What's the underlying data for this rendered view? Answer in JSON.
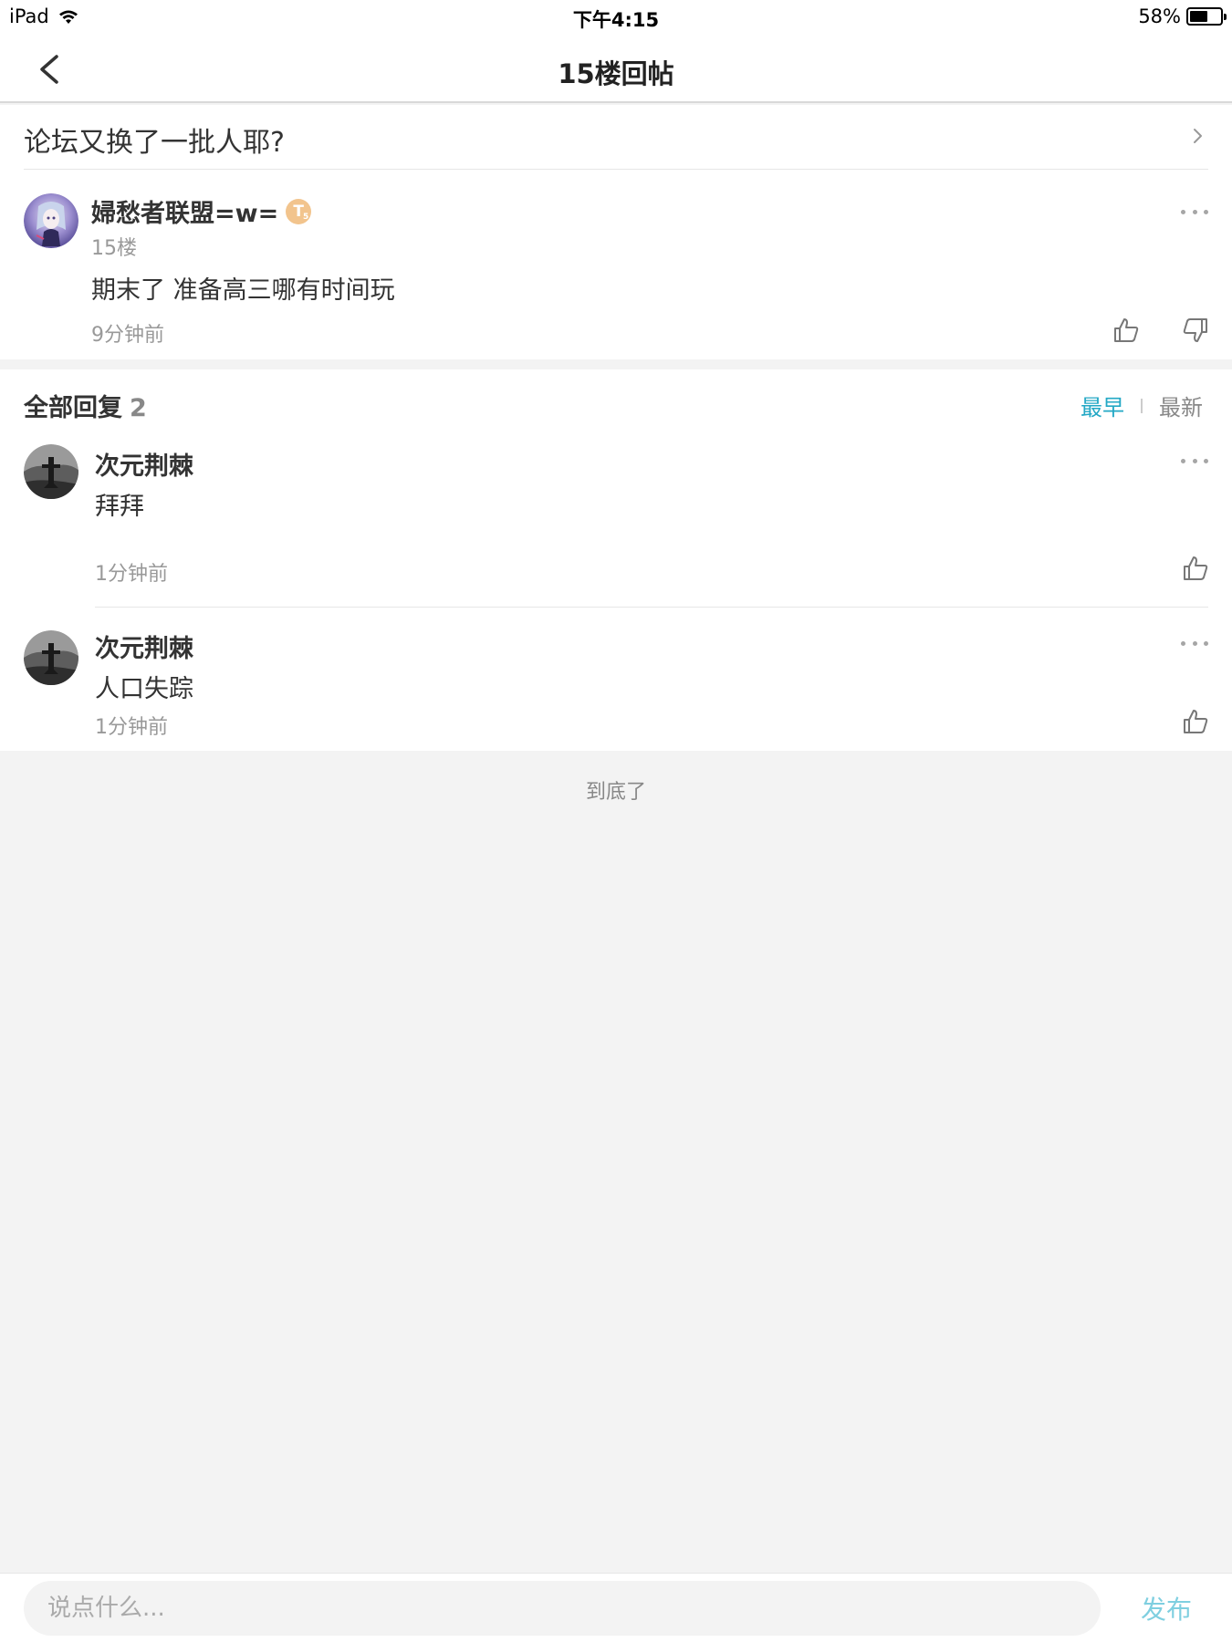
{
  "status_bar": {
    "device": "iPad",
    "time": "下午4:15",
    "battery_percent": "58%",
    "battery_level": 0.58
  },
  "nav": {
    "title": "15楼回帖"
  },
  "thread": {
    "title": "论坛又换了一批人耶?"
  },
  "floor_post": {
    "author": "婦愁者联盟=w=",
    "level_badge": "T",
    "level_number": "5",
    "floor": "15楼",
    "content": "期末了  准备高三哪有时间玩",
    "time": "9分钟前"
  },
  "replies": {
    "header": "全部回复",
    "count": "2",
    "sort_earliest": "最早",
    "sort_latest": "最新",
    "items": [
      {
        "author": "次元荆棘",
        "content": "拜拜",
        "time": "1分钟前"
      },
      {
        "author": "次元荆棘",
        "content": "人口失踪",
        "time": "1分钟前"
      }
    ]
  },
  "end_text": "到底了",
  "input": {
    "placeholder": "说点什么...",
    "publish_label": "发布"
  },
  "colors": {
    "accent": "#23a8c5",
    "publish": "#7fcfe0",
    "badge": "#f2c48d"
  }
}
